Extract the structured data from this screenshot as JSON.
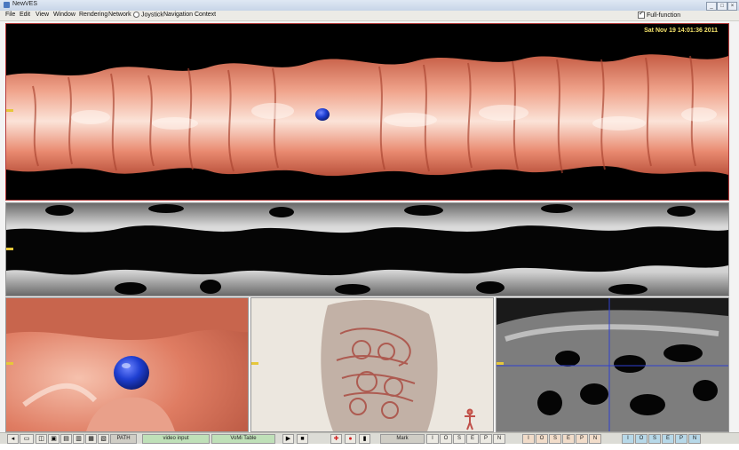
{
  "window": {
    "title": "NewVES"
  },
  "menu": [
    "File",
    "Edit",
    "View",
    "Window",
    "Rendering",
    "Network",
    "Joystick",
    "Navigation",
    "Context"
  ],
  "full_function": "Full-function",
  "viewer": {
    "datetime": "Sat Nov 19 14:01:36 2011"
  },
  "toolbar": {
    "path": "PATH",
    "video": "video input",
    "vomit": "VoMi Table",
    "mark": "Mark",
    "group1": [
      "I",
      "O",
      "S",
      "E",
      "P",
      "N"
    ],
    "group2": [
      "I",
      "O",
      "S",
      "E",
      "P",
      "N"
    ],
    "group3": [
      "I",
      "O",
      "S",
      "E",
      "P",
      "N"
    ]
  },
  "colors": {
    "tissue": "#e7876d",
    "polyp": "#1f3fd2",
    "frame_active": "#b53a3a"
  }
}
